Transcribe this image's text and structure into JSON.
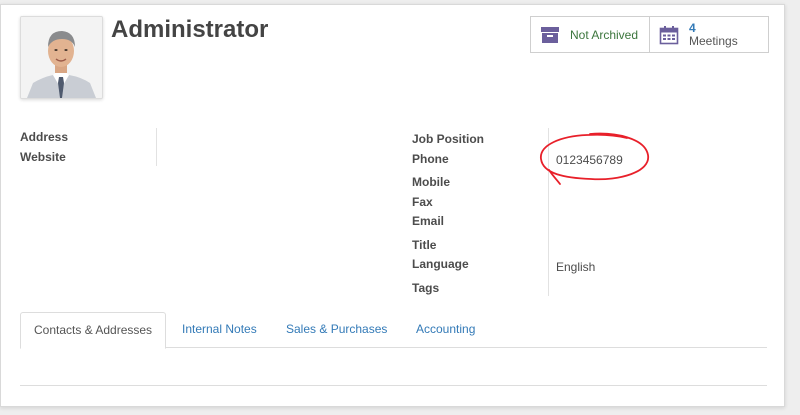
{
  "header": {
    "title": "Administrator",
    "avatar_alt": "Administrator photo"
  },
  "smart_buttons": {
    "archive": {
      "icon": "archive-box-icon",
      "label": "Not Archived",
      "color": "#3c763d"
    },
    "meetings": {
      "icon": "calendar-icon",
      "count": "4",
      "label": "Meetings"
    }
  },
  "left_fields": {
    "address_label": "Address",
    "website_label": "Website"
  },
  "right_fields": {
    "job_position_label": "Job Position",
    "phone_label": "Phone",
    "phone_value": "0123456789",
    "mobile_label": "Mobile",
    "fax_label": "Fax",
    "email_label": "Email",
    "title_label": "Title",
    "language_label": "Language",
    "language_value": "English",
    "tags_label": "Tags"
  },
  "tabs": [
    {
      "label": "Contacts & Addresses",
      "active": true
    },
    {
      "label": "Internal Notes",
      "active": false
    },
    {
      "label": "Sales & Purchases",
      "active": false
    },
    {
      "label": "Accounting",
      "active": false
    }
  ],
  "annotation": {
    "color": "#e8202a"
  }
}
